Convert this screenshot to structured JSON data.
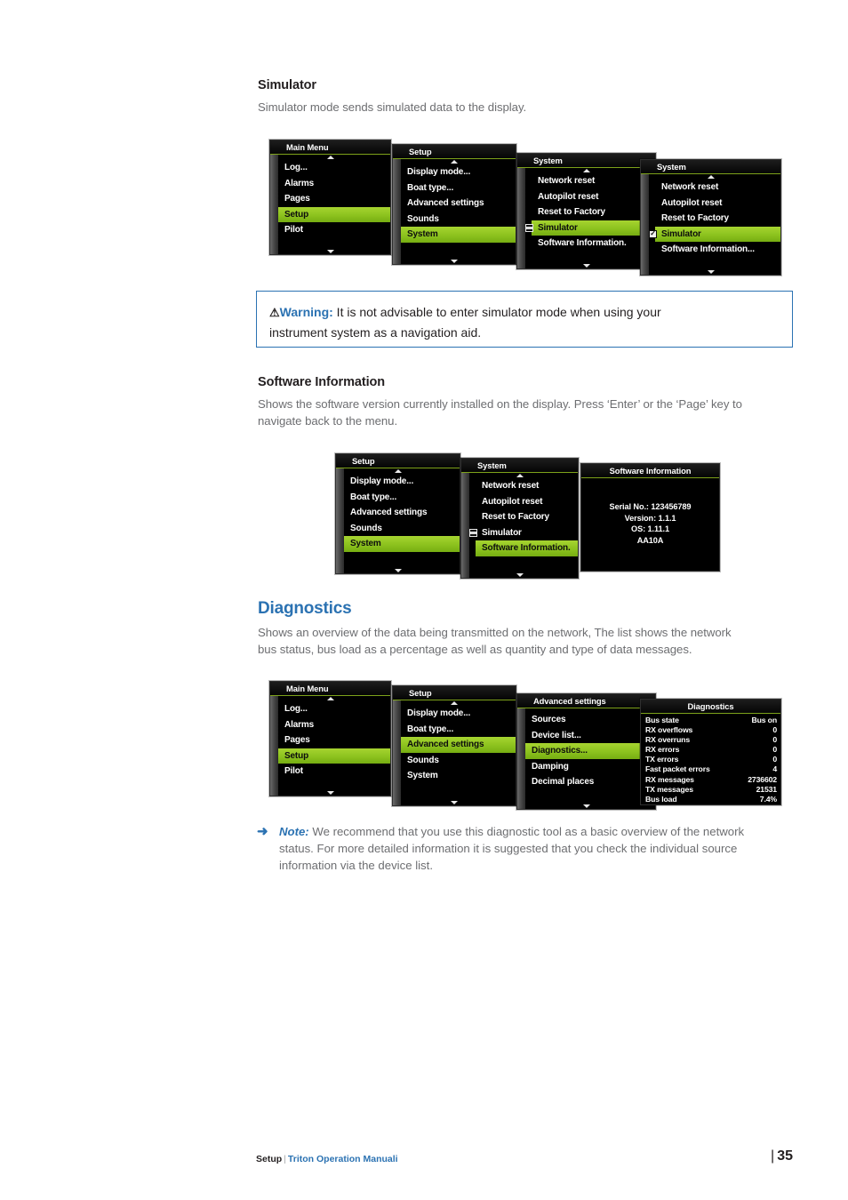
{
  "sections": {
    "simulator": {
      "heading": "Simulator",
      "body": "Simulator mode sends simulated data to the display."
    },
    "software_information": {
      "heading": "Software Information",
      "body_line1": "Shows the software version currently installed on the display. Press ‘Enter’ or the ‘Page’ key to",
      "body_line2": "navigate back to the menu."
    },
    "diagnostics": {
      "heading": "Diagnostics",
      "body_line1": "Shows an overview of the data being transmitted on the network, The list shows the network",
      "body_line2": "bus status, bus load as a percentage as well as quantity and type of data messages."
    }
  },
  "warning": {
    "icon": "warning-triangle-icon",
    "glyph": "⚠",
    "label": "Warning:",
    "line1": " It is not advisable to enter simulator mode when using your",
    "line2": "instrument system as a navigation aid."
  },
  "note": {
    "arrow_glyph": "➜",
    "label": "Note:",
    "line1": " We recommend that you use this diagnostic tool as a basic overview of the network",
    "line2": "status. For more detailed information it is suggested that you check the individual source",
    "line3": "information via the device list."
  },
  "figure1": {
    "panels": [
      {
        "title": "Main Menu",
        "items": [
          {
            "label": "Log...",
            "highlighted": false
          },
          {
            "label": "Alarms",
            "highlighted": false
          },
          {
            "label": "Pages",
            "highlighted": false
          },
          {
            "label": "Setup",
            "highlighted": true
          },
          {
            "label": "Pilot",
            "highlighted": false
          }
        ]
      },
      {
        "title": "Setup",
        "items": [
          {
            "label": "Display mode...",
            "highlighted": false
          },
          {
            "label": "Boat type...",
            "highlighted": false
          },
          {
            "label": "Advanced settings",
            "highlighted": false
          },
          {
            "label": "Sounds",
            "highlighted": false
          },
          {
            "label": "System",
            "highlighted": true
          }
        ]
      },
      {
        "title": "System",
        "items": [
          {
            "label": "Network reset",
            "highlighted": false
          },
          {
            "label": "Autopilot reset",
            "highlighted": false
          },
          {
            "label": "Reset to Factory",
            "highlighted": false
          },
          {
            "label": "Simulator",
            "highlighted": true,
            "checkbox": "unchecked"
          },
          {
            "label": "Software Information.",
            "highlighted": false
          }
        ]
      },
      {
        "title": "System",
        "items": [
          {
            "label": "Network reset",
            "highlighted": false
          },
          {
            "label": "Autopilot reset",
            "highlighted": false
          },
          {
            "label": "Reset to Factory",
            "highlighted": false
          },
          {
            "label": "Simulator",
            "highlighted": true,
            "checkbox": "checked"
          },
          {
            "label": "Software Information...",
            "highlighted": false
          }
        ]
      }
    ]
  },
  "figure2": {
    "panels": [
      {
        "title": "Setup",
        "items": [
          {
            "label": "Display mode...",
            "highlighted": false
          },
          {
            "label": "Boat type...",
            "highlighted": false
          },
          {
            "label": "Advanced settings",
            "highlighted": false
          },
          {
            "label": "Sounds",
            "highlighted": false
          },
          {
            "label": "System",
            "highlighted": true
          }
        ]
      },
      {
        "title": "System",
        "items": [
          {
            "label": "Network reset",
            "highlighted": false
          },
          {
            "label": "Autopilot reset",
            "highlighted": false
          },
          {
            "label": "Reset to Factory",
            "highlighted": false
          },
          {
            "label": "Simulator",
            "highlighted": false,
            "checkbox": "unchecked"
          },
          {
            "label": "Software Information.",
            "highlighted": true
          }
        ]
      }
    ],
    "info_panel": {
      "title": "Software Information",
      "lines": [
        "Serial No.: 123456789",
        "Version: 1.1.1",
        "OS: 1.11.1",
        "AA10A"
      ]
    }
  },
  "figure3": {
    "panels": [
      {
        "title": "Main Menu",
        "items": [
          {
            "label": "Log...",
            "highlighted": false
          },
          {
            "label": "Alarms",
            "highlighted": false
          },
          {
            "label": "Pages",
            "highlighted": false
          },
          {
            "label": "Setup",
            "highlighted": true
          },
          {
            "label": "Pilot",
            "highlighted": false
          }
        ]
      },
      {
        "title": "Setup",
        "items": [
          {
            "label": "Display mode...",
            "highlighted": false
          },
          {
            "label": "Boat type...",
            "highlighted": false
          },
          {
            "label": "Advanced settings",
            "highlighted": true
          },
          {
            "label": "Sounds",
            "highlighted": false
          },
          {
            "label": "System",
            "highlighted": false
          }
        ]
      },
      {
        "title": "Advanced settings",
        "items": [
          {
            "label": "Sources",
            "highlighted": false
          },
          {
            "label": "Device list...",
            "highlighted": false
          },
          {
            "label": "Diagnostics...",
            "highlighted": true
          },
          {
            "label": "Damping",
            "highlighted": false
          },
          {
            "label": "Decimal places",
            "highlighted": false
          }
        ]
      }
    ],
    "diagnostics_panel": {
      "title": "Diagnostics",
      "rows": [
        {
          "key": "Bus state",
          "value": "Bus on"
        },
        {
          "key": "RX overflows",
          "value": "0"
        },
        {
          "key": "RX overruns",
          "value": "0"
        },
        {
          "key": "RX errors",
          "value": "0"
        },
        {
          "key": "TX errors",
          "value": "0"
        },
        {
          "key": "Fast packet errors",
          "value": "4"
        },
        {
          "key": "RX messages",
          "value": "2736602"
        },
        {
          "key": "TX messages",
          "value": "21531"
        },
        {
          "key": "Bus load",
          "value": "7.4%"
        }
      ]
    }
  },
  "footer": {
    "left": "Setup",
    "separator": "|",
    "manual": "Triton Operation Manuali",
    "page_bar": "|",
    "page_number": "35"
  },
  "colors": {
    "accent_blue": "#2b72b2",
    "highlight_green": "#8cc21e",
    "title_rule_green": "#7da21a",
    "body_gray": "#6d6e71",
    "menu_black": "#000000"
  }
}
